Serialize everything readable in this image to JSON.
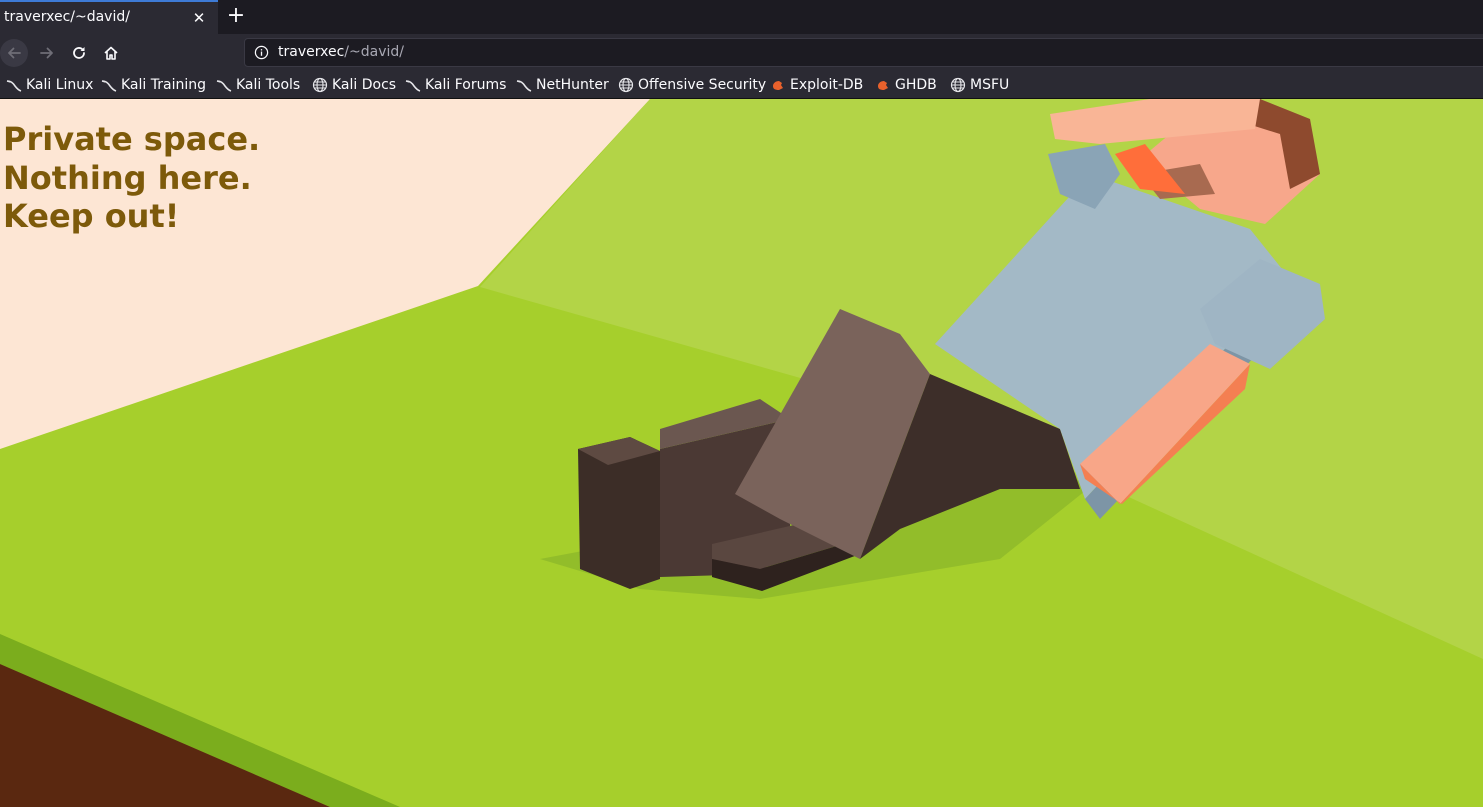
{
  "tab": {
    "title": "traverxec/~david/",
    "close_glyph": "✕",
    "new_tab_glyph": "+"
  },
  "nav": {
    "back_icon": "arrow-left-icon",
    "forward_icon": "arrow-right-icon",
    "reload_icon": "reload-icon",
    "home_icon": "home-icon"
  },
  "urlbar": {
    "host": "traverxec",
    "path": "/~david/",
    "info_icon": "info-icon"
  },
  "bookmarks": [
    {
      "label": "Kali Linux",
      "icon": "kali-dragon-icon"
    },
    {
      "label": "Kali Training",
      "icon": "kali-dragon-icon"
    },
    {
      "label": "Kali Tools",
      "icon": "kali-dragon-icon"
    },
    {
      "label": "Kali Docs",
      "icon": "globe-icon"
    },
    {
      "label": "Kali Forums",
      "icon": "kali-dragon-icon"
    },
    {
      "label": "NetHunter",
      "icon": "kali-dragon-icon"
    },
    {
      "label": "Offensive Security",
      "icon": "globe-icon"
    },
    {
      "label": "Exploit-DB",
      "icon": "exploit-db-icon"
    },
    {
      "label": "GHDB",
      "icon": "exploit-db-icon"
    },
    {
      "label": "MSFU",
      "icon": "globe-icon"
    }
  ],
  "page": {
    "lines": [
      "Private space.",
      "Nothing here.",
      "Keep out!"
    ],
    "text_color": "#7d5a0a"
  },
  "colors": {
    "accent": "#3e7bd6",
    "chrome": "#2b2a33",
    "tabstrip": "#1c1b22",
    "grass": "#a8d02e",
    "wall": "#fde7d6",
    "soil": "#5a2810"
  }
}
